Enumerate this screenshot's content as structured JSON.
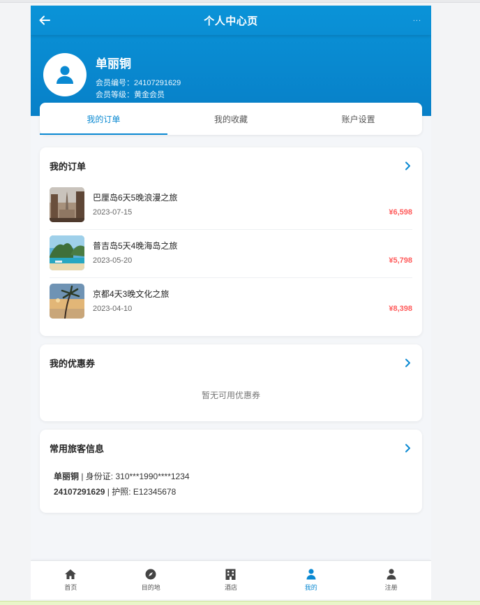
{
  "colors": {
    "primary": "#0a89d2",
    "price": "#ff5a5a",
    "header_bg": "#0a93d8"
  },
  "navbar": {
    "title": "个人中心页",
    "back_icon": "arrow-left-icon",
    "more_label": "..."
  },
  "profile": {
    "name": "单丽铜",
    "member_no_label": "会员编号：24107291629",
    "member_level_label": "会员等级：黄金会员",
    "avatar_icon": "user-icon"
  },
  "tabs": [
    {
      "label": "我的订单",
      "active": true
    },
    {
      "label": "我的收藏",
      "active": false
    },
    {
      "label": "账户设置",
      "active": false
    }
  ],
  "orders_card": {
    "title": "我的订单",
    "orders": [
      {
        "name": "巴厘岛6天5晚浪漫之旅",
        "date": "2023-07-15",
        "price": "¥6,598"
      },
      {
        "name": "普吉岛5天4晚海岛之旅",
        "date": "2023-05-20",
        "price": "¥5,798"
      },
      {
        "name": "京都4天3晚文化之旅",
        "date": "2023-04-10",
        "price": "¥8,398"
      }
    ]
  },
  "coupons_card": {
    "title": "我的优惠券",
    "empty_text": "暂无可用优惠券"
  },
  "travelers_card": {
    "title": "常用旅客信息",
    "line1_bold": "单丽铜",
    "line1_rest": " | 身份证: 310***1990****1234",
    "line2_bold": "24107291629",
    "line2_rest": " | 护照: E12345678"
  },
  "bottom_nav": [
    {
      "label": "首页",
      "icon": "home-icon",
      "active": false
    },
    {
      "label": "目的地",
      "icon": "compass-icon",
      "active": false
    },
    {
      "label": "酒店",
      "icon": "hotel-icon",
      "active": false
    },
    {
      "label": "我的",
      "icon": "user-icon",
      "active": true
    },
    {
      "label": "注册",
      "icon": "user-icon",
      "active": false
    }
  ]
}
